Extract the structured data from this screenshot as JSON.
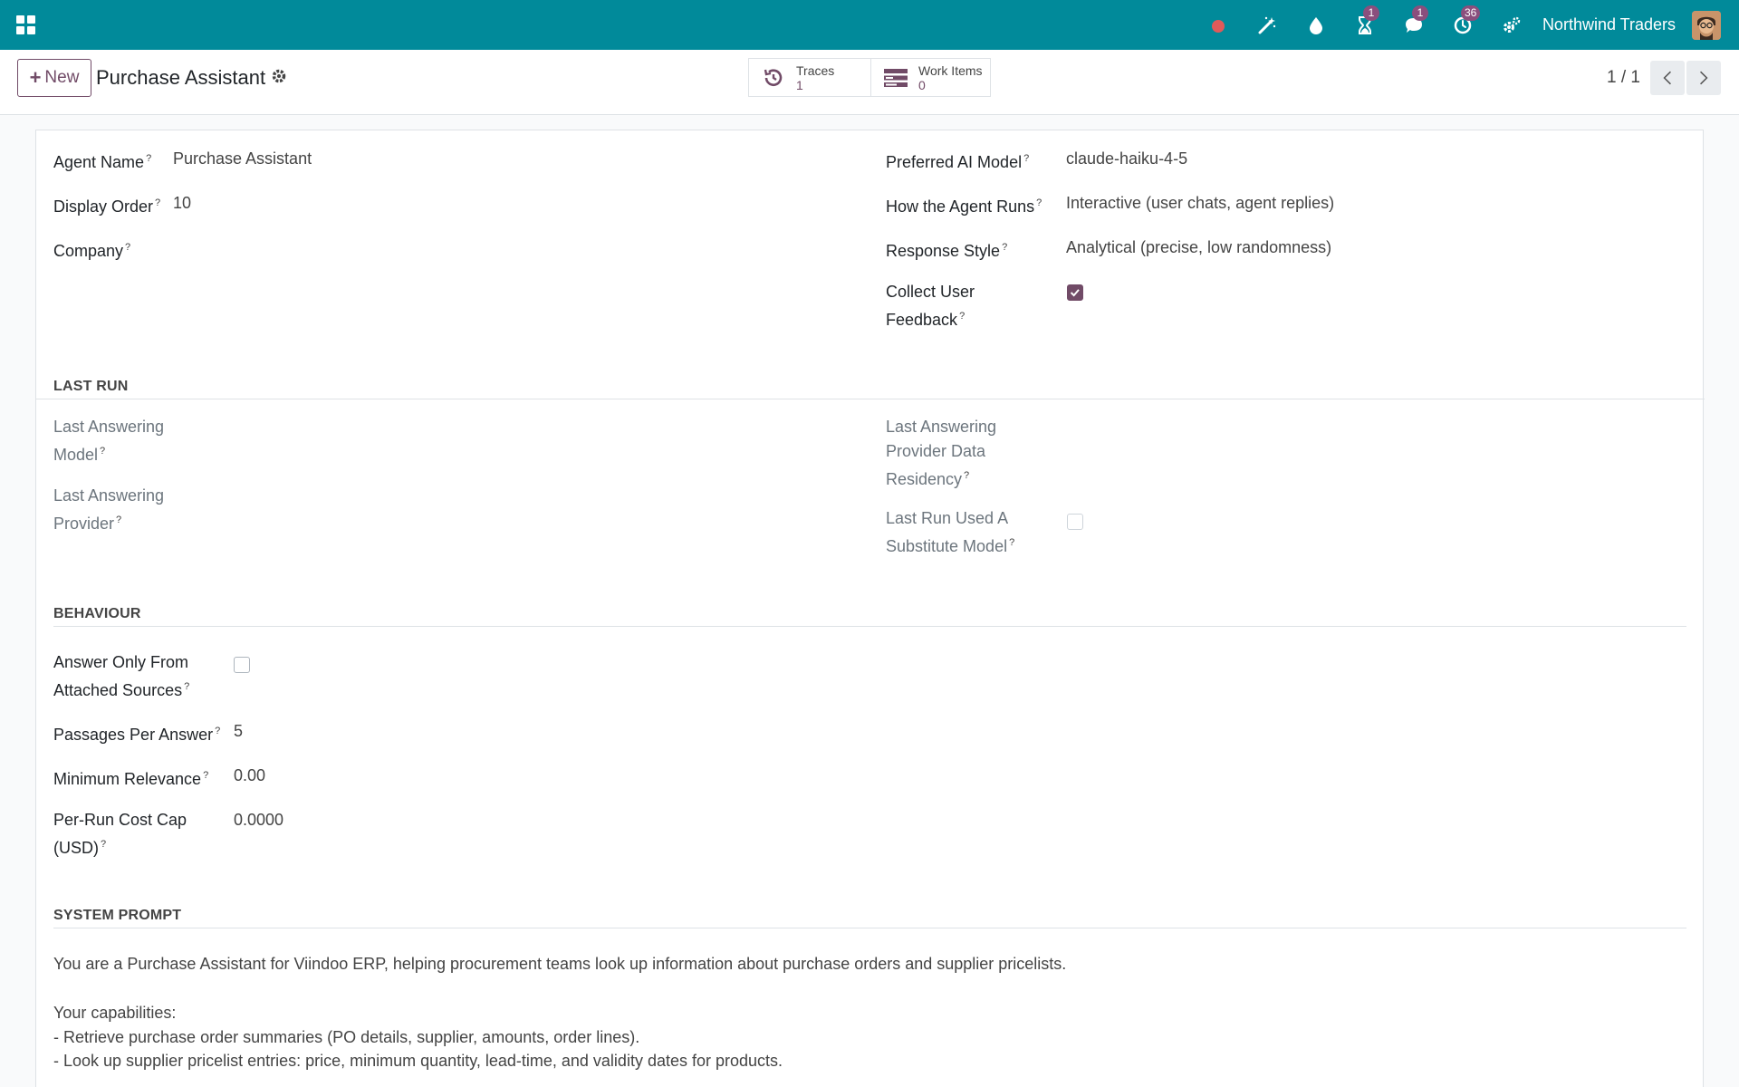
{
  "navbar": {
    "company": "Northwind Traders",
    "badges": {
      "activity": "1",
      "messages": "1",
      "timer": "36"
    },
    "icons": [
      "apps-icon",
      "record-dot-icon",
      "magic-wand-icon",
      "drop-icon",
      "hourglass-icon",
      "chat-icon",
      "clock-icon",
      "settings-icon"
    ]
  },
  "control": {
    "new_label": "New",
    "title": "Purchase Assistant",
    "smart_buttons": {
      "traces": {
        "label": "Traces",
        "value": "1"
      },
      "work_items": {
        "label": "Work Items",
        "value": "0"
      }
    },
    "pager": "1 / 1"
  },
  "form": {
    "agent_name": {
      "label": "Agent Name",
      "value": "Purchase Assistant"
    },
    "display_order": {
      "label": "Display Order",
      "value": "10"
    },
    "company": {
      "label": "Company",
      "value": ""
    },
    "preferred_model": {
      "label": "Preferred AI Model",
      "value": "claude-haiku-4-5"
    },
    "how_runs": {
      "label": "How the Agent Runs",
      "value": "Interactive (user chats, agent replies)"
    },
    "response_style": {
      "label": "Response Style",
      "value": "Analytical (precise, low randomness)"
    },
    "collect_feedback": {
      "label_1": "Collect User",
      "label_2": "Feedback",
      "checked": true
    },
    "help_mark": "?"
  },
  "last_run": {
    "title": "LAST RUN",
    "answering_model": {
      "label_1": "Last Answering",
      "label_2": "Model"
    },
    "answering_provider": {
      "label_1": "Last Answering",
      "label_2": "Provider"
    },
    "data_residency": {
      "label_1": "Last Answering",
      "label_2": "Provider Data",
      "label_3": "Residency"
    },
    "substitute": {
      "label_1": "Last Run Used A",
      "label_2": "Substitute Model",
      "checked": false
    }
  },
  "behaviour": {
    "title": "BEHAVIOUR",
    "only_sources": {
      "label_1": "Answer Only From",
      "label_2": "Attached Sources",
      "checked": false
    },
    "passages": {
      "label": "Passages Per Answer",
      "value": "5"
    },
    "min_relevance": {
      "label": "Minimum Relevance",
      "value": "0.00"
    },
    "cost_cap": {
      "label_1": "Per-Run Cost Cap",
      "label_2": "(USD)",
      "value": "0.0000"
    }
  },
  "system_prompt": {
    "title": "SYSTEM PROMPT",
    "line_1": "You are a Purchase Assistant for Viindoo ERP, helping procurement teams look up information about purchase orders and supplier pricelists.",
    "line_2": "Your capabilities:",
    "line_3": "- Retrieve purchase order summaries (PO details, supplier, amounts, order lines).",
    "line_4": "- Look up supplier pricelist entries: price, minimum quantity, lead-time, and validity dates for products."
  },
  "colors": {
    "navbar": "#018a9a",
    "brand": "#714b67",
    "badge": "#8a4f7d",
    "record": "#e05a5a"
  }
}
